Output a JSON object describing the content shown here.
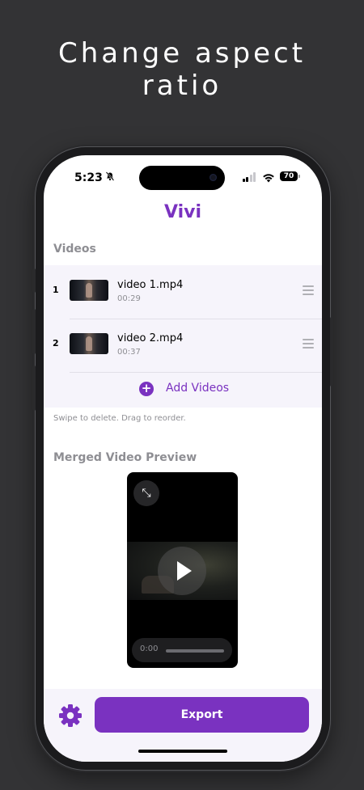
{
  "headline": {
    "line1": "Change aspect",
    "line2": "ratio"
  },
  "status_bar": {
    "time": "5:23",
    "battery": "70"
  },
  "app": {
    "title": "Vivi"
  },
  "videos_section": {
    "label": "Videos",
    "items": [
      {
        "index": "1",
        "name": "video 1.mp4",
        "duration": "00:29"
      },
      {
        "index": "2",
        "name": "video 2.mp4",
        "duration": "00:37"
      }
    ],
    "add_label": "Add Videos",
    "hint": "Swipe to delete. Drag to reorder."
  },
  "preview_section": {
    "label": "Merged Video Preview",
    "time": "0:00"
  },
  "bottom": {
    "export_label": "Export"
  },
  "colors": {
    "accent": "#7a32c0",
    "background": "#333335"
  }
}
